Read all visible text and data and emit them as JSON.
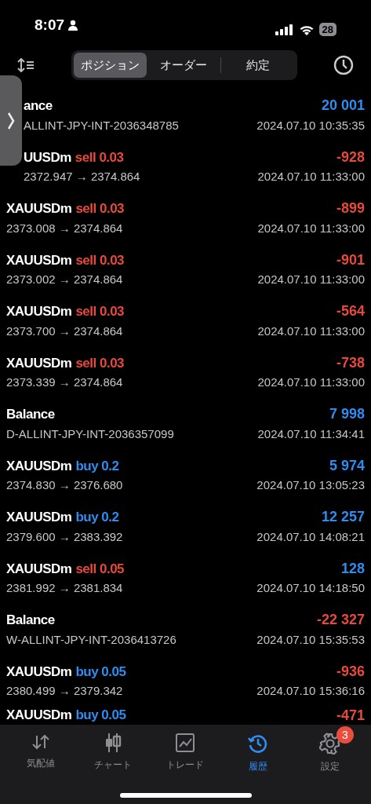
{
  "status_bar": {
    "time": "8:07",
    "battery": "28"
  },
  "tabs": [
    {
      "label": "ポジション",
      "selected": true
    },
    {
      "label": "オーダー",
      "selected": false
    },
    {
      "label": "約定",
      "selected": false
    }
  ],
  "rows": [
    {
      "kind": "balance",
      "covered": true,
      "title": "ance",
      "subtitle": "ALLINT-JPY-INT-2036348785",
      "value": "20 001",
      "negative": false,
      "time": "2024.07.10 10:35:35"
    },
    {
      "kind": "trade",
      "covered": true,
      "title": "UUSDm",
      "side": "sell 0.03",
      "sell": true,
      "subtitle": "2372.947 → 2374.864",
      "value": "-928",
      "negative": true,
      "time": "2024.07.10 11:33:00"
    },
    {
      "kind": "trade",
      "covered": false,
      "title": "XAUUSDm",
      "side": "sell 0.03",
      "sell": true,
      "subtitle": "2373.008 → 2374.864",
      "value": "-899",
      "negative": true,
      "time": "2024.07.10 11:33:00"
    },
    {
      "kind": "trade",
      "covered": false,
      "title": "XAUUSDm",
      "side": "sell 0.03",
      "sell": true,
      "subtitle": "2373.002 → 2374.864",
      "value": "-901",
      "negative": true,
      "time": "2024.07.10 11:33:00"
    },
    {
      "kind": "trade",
      "covered": false,
      "title": "XAUUSDm",
      "side": "sell 0.03",
      "sell": true,
      "subtitle": "2373.700 → 2374.864",
      "value": "-564",
      "negative": true,
      "time": "2024.07.10 11:33:00"
    },
    {
      "kind": "trade",
      "covered": false,
      "title": "XAUUSDm",
      "side": "sell 0.03",
      "sell": true,
      "subtitle": "2373.339 → 2374.864",
      "value": "-738",
      "negative": true,
      "time": "2024.07.10 11:33:00"
    },
    {
      "kind": "balance",
      "covered": false,
      "title": "Balance",
      "subtitle": "D-ALLINT-JPY-INT-2036357099",
      "value": "7 998",
      "negative": false,
      "time": "2024.07.10 11:34:41"
    },
    {
      "kind": "trade",
      "covered": false,
      "title": "XAUUSDm",
      "side": "buy 0.2",
      "sell": false,
      "subtitle": "2374.830 → 2376.680",
      "value": "5 974",
      "negative": false,
      "time": "2024.07.10 13:05:23"
    },
    {
      "kind": "trade",
      "covered": false,
      "title": "XAUUSDm",
      "side": "buy 0.2",
      "sell": false,
      "subtitle": "2379.600 → 2383.392",
      "value": "12 257",
      "negative": false,
      "time": "2024.07.10 14:08:21"
    },
    {
      "kind": "trade",
      "covered": false,
      "title": "XAUUSDm",
      "side": "sell 0.05",
      "sell": true,
      "subtitle": "2381.992 → 2381.834",
      "value": "128",
      "negative": false,
      "time": "2024.07.10 14:18:50"
    },
    {
      "kind": "balance",
      "covered": false,
      "title": "Balance",
      "subtitle": "W-ALLINT-JPY-INT-2036413726",
      "value": "-22 327",
      "negative": true,
      "time": "2024.07.10 15:35:53"
    },
    {
      "kind": "trade",
      "covered": false,
      "title": "XAUUSDm",
      "side": "buy 0.05",
      "sell": false,
      "subtitle": "2380.499 → 2379.342",
      "value": "-936",
      "negative": true,
      "time": "2024.07.10 15:36:16"
    },
    {
      "kind": "trade",
      "covered": false,
      "title": "XAUUSDm",
      "side": "buy 0.05",
      "sell": false,
      "value": "-471",
      "negative": true
    }
  ],
  "nav": [
    {
      "label": "気配値",
      "selected": false
    },
    {
      "label": "チャート",
      "selected": false
    },
    {
      "label": "トレード",
      "selected": false
    },
    {
      "label": "履歴",
      "selected": true
    },
    {
      "label": "設定",
      "selected": false,
      "badge": "3"
    }
  ]
}
